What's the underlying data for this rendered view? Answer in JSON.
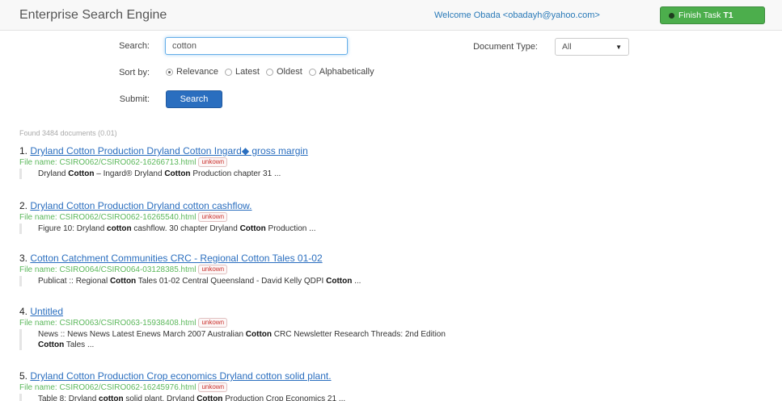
{
  "header": {
    "brand": "Enterprise Search Engine",
    "welcome": "Welcome Obada <obadayh@yahoo.com>",
    "finish_label": "Finish Task",
    "finish_task_id": "T1"
  },
  "form": {
    "search_label": "Search:",
    "search_value": "cotton",
    "doctype_label": "Document Type:",
    "doctype_selected": "All",
    "sort_label": "Sort by:",
    "sort_options": [
      {
        "label": "Relevance",
        "checked": true
      },
      {
        "label": "Latest",
        "checked": false
      },
      {
        "label": "Oldest",
        "checked": false
      },
      {
        "label": "Alphabetically",
        "checked": false
      }
    ],
    "submit_label": "Submit:",
    "search_button": "Search"
  },
  "results": {
    "summary": "Found 3484 documents (0.01)",
    "items": [
      {
        "num": "1.",
        "title": "Dryland Cotton Production Dryland Cotton Ingard◆ gross margin",
        "file": "File name: CSIRO062/CSIRO062-16266713.html",
        "tag": "unkown",
        "snippet": [
          [
            "Dryland ",
            false
          ],
          [
            "Cotton",
            true
          ],
          [
            " – Ingard® Dryland ",
            false
          ],
          [
            "Cotton",
            true
          ],
          [
            " Production chapter 31 ...",
            false
          ]
        ]
      },
      {
        "num": "2.",
        "title": "Dryland Cotton Production Dryland cotton cashflow.",
        "file": "File name: CSIRO062/CSIRO062-16265540.html",
        "tag": "unkown",
        "snippet": [
          [
            "Figure 10: Dryland ",
            false
          ],
          [
            "cotton",
            true
          ],
          [
            " cashflow. 30 chapter Dryland ",
            false
          ],
          [
            "Cotton",
            true
          ],
          [
            " Production ...",
            false
          ]
        ]
      },
      {
        "num": "3.",
        "title": "Cotton Catchment Communities CRC - Regional Cotton Tales 01-02",
        "file": "File name: CSIRO064/CSIRO064-03128385.html",
        "tag": "unkown",
        "snippet": [
          [
            "Publicat :: Regional ",
            false
          ],
          [
            "Cotton",
            true
          ],
          [
            " Tales 01-02 Central Queensland - David Kelly QDPI ",
            false
          ],
          [
            "Cotton",
            true
          ],
          [
            " ...",
            false
          ]
        ]
      },
      {
        "num": "4.",
        "title": "Untitled",
        "file": "File name: CSIRO063/CSIRO063-15938408.html",
        "tag": "unkown",
        "snippet": [
          [
            "News :: News News Latest Enews March 2007 Australian ",
            false
          ],
          [
            "Cotton",
            true
          ],
          [
            " CRC Newsletter Research Threads: 2nd Edition",
            false
          ],
          [
            "\n",
            false
          ],
          [
            "Cotton",
            true
          ],
          [
            " Tales ...",
            false
          ]
        ]
      },
      {
        "num": "5.",
        "title": "Dryland Cotton Production Crop economics Dryland cotton solid plant.",
        "file": "File name: CSIRO062/CSIRO062-16245976.html",
        "tag": "unkown",
        "snippet": [
          [
            "Table 8: Dryland ",
            false
          ],
          [
            "cotton",
            true
          ],
          [
            " solid plant. Dryland ",
            false
          ],
          [
            "Cotton",
            true
          ],
          [
            " Production Crop Economics 21 ...",
            false
          ]
        ]
      }
    ]
  }
}
